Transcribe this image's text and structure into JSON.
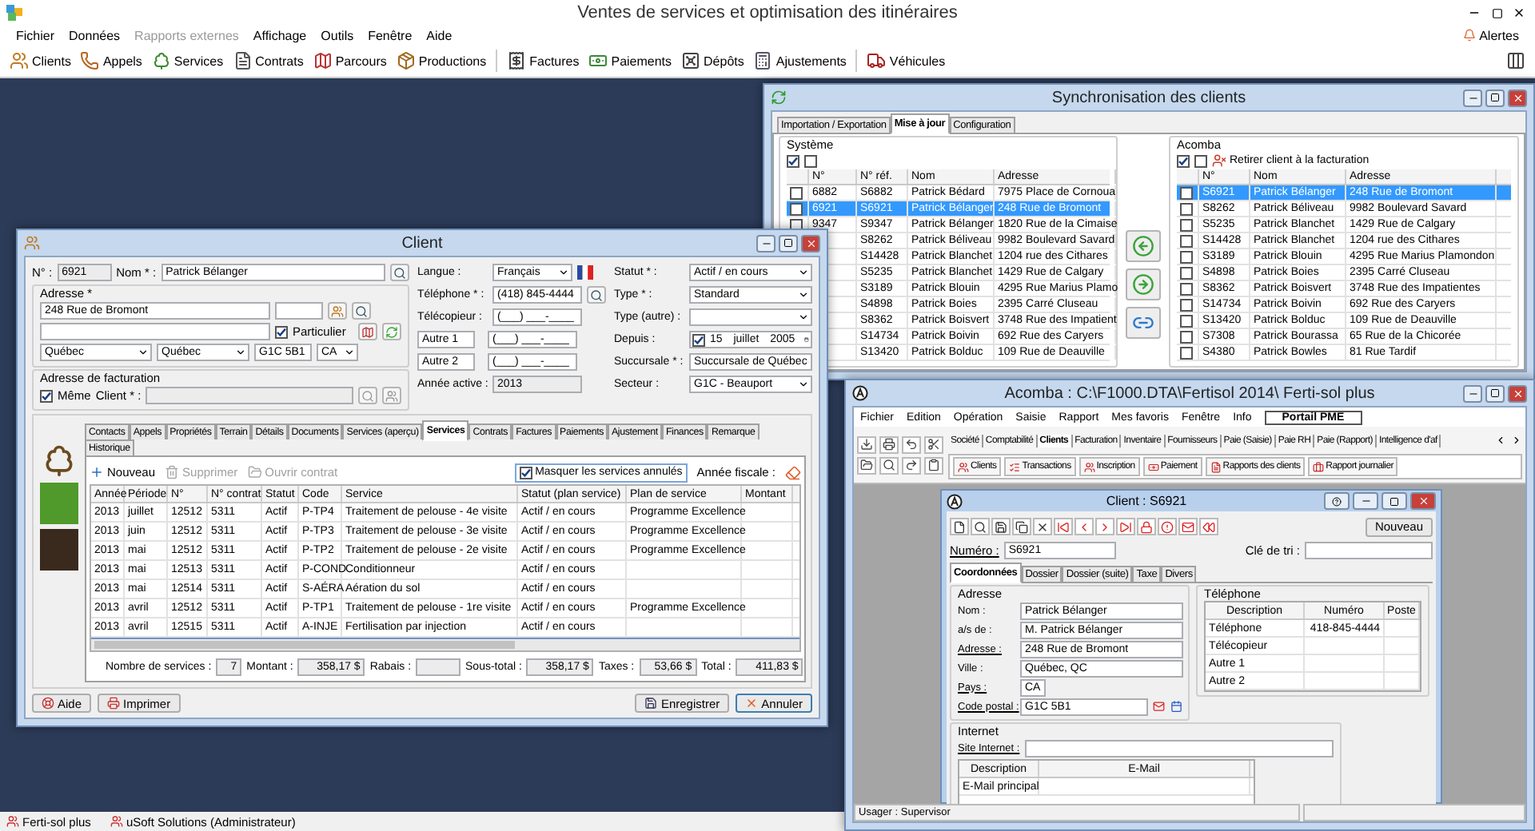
{
  "app": {
    "title": "Ventes de services et optimisation des itinéraires",
    "menu": [
      {
        "label": "Fichier",
        "disabled": false
      },
      {
        "label": "Données",
        "disabled": false
      },
      {
        "label": "Rapports externes",
        "disabled": true
      },
      {
        "label": "Affichage",
        "disabled": false
      },
      {
        "label": "Outils",
        "disabled": false
      },
      {
        "label": "Fenêtre",
        "disabled": false
      },
      {
        "label": "Aide",
        "disabled": false
      }
    ],
    "alerts": "Alertes",
    "toolbar": [
      "Clients",
      "Appels",
      "Services",
      "Contrats",
      "Parcours",
      "Productions",
      "Factures",
      "Paiements",
      "Dépôts",
      "Ajustements",
      "Véhicules"
    ],
    "status_bar": [
      "Ferti-sol plus",
      "uSoft Solutions (Administrateur)"
    ]
  },
  "sync_window": {
    "title": "Synchronisation des clients",
    "tabs": [
      {
        "label": "Importation / Exportation",
        "selected": false
      },
      {
        "label": "Mise à jour",
        "selected": true
      },
      {
        "label": "Configuration",
        "selected": false
      }
    ],
    "system": {
      "legend": "Système",
      "bulk": [
        {
          "checked": true
        },
        {
          "checked": false
        }
      ],
      "columns": [
        "N°",
        "N° réf.",
        "Nom",
        "Adresse"
      ],
      "rows": [
        {
          "no": "6882",
          "checked": false,
          "selected": false,
          "ref": "S6882",
          "name": "Patrick Bédard",
          "address": "7975 Place de Cornoua"
        },
        {
          "no": "6921",
          "checked": false,
          "selected": true,
          "ref": "S6921",
          "name": "Patrick Bélanger",
          "address": "248 Rue de Bromont"
        },
        {
          "no": "9347",
          "checked": false,
          "selected": false,
          "ref": "S9347",
          "name": "Patrick Bélanger",
          "address": "1820 Rue de la Cimaise"
        },
        {
          "selected": false,
          "ref": "S8262",
          "name": "Patrick Béliveau",
          "address": "9982 Boulevard Savard"
        },
        {
          "selected": false,
          "ref": "S14428",
          "name": "Patrick Blanchet",
          "address": "1204 rue des Cithares"
        },
        {
          "selected": false,
          "ref": "S5235",
          "name": "Patrick Blanchet",
          "address": "1429 Rue de Calgary"
        },
        {
          "selected": false,
          "ref": "S3189",
          "name": "Patrick Blouin",
          "address": "4295 Rue Marius Plamo"
        },
        {
          "selected": false,
          "ref": "S4898",
          "name": "Patrick Boies",
          "address": "2395 Carré Cluseau"
        },
        {
          "selected": false,
          "ref": "S8362",
          "name": "Patrick Boisvert",
          "address": "3748 Rue des Impatient"
        },
        {
          "selected": false,
          "ref": "S14734",
          "name": "Patrick Boivin",
          "address": "692 Rue des Caryers"
        },
        {
          "selected": false,
          "ref": "S13420",
          "name": "Patrick Bolduc",
          "address": "109 Rue de Deauville"
        }
      ]
    },
    "acomba": {
      "legend": "Acomba",
      "bulk": [
        {
          "checked": true
        },
        {
          "checked": false
        }
      ],
      "remove_button": "Retirer client à la facturation",
      "columns": [
        "N°",
        "Nom",
        "Adresse"
      ],
      "rows": [
        {
          "no": "S6921",
          "checked": false,
          "selected": true,
          "name": "Patrick Bélanger",
          "address": "248 Rue de Bromont"
        },
        {
          "no": "S8262",
          "checked": false,
          "selected": false,
          "name": "Patrick Béliveau",
          "address": "9982 Boulevard Savard"
        },
        {
          "no": "S5235",
          "checked": false,
          "selected": false,
          "name": "Patrick Blanchet",
          "address": "1429 Rue de Calgary"
        },
        {
          "no": "S14428",
          "checked": false,
          "selected": false,
          "name": "Patrick Blanchet",
          "address": "1204 rue des Cithares"
        },
        {
          "no": "S3189",
          "checked": false,
          "selected": false,
          "name": "Patrick Blouin",
          "address": "4295 Rue Marius Plamondon"
        },
        {
          "no": "S4898",
          "checked": false,
          "selected": false,
          "name": "Patrick Boies",
          "address": "2395 Carré Cluseau"
        },
        {
          "no": "S8362",
          "checked": false,
          "selected": false,
          "name": "Patrick Boisvert",
          "address": "3748 Rue des Impatientes"
        },
        {
          "no": "S14734",
          "checked": false,
          "selected": false,
          "name": "Patrick Boivin",
          "address": "692 Rue des Caryers"
        },
        {
          "no": "S13420",
          "checked": false,
          "selected": false,
          "name": "Patrick Bolduc",
          "address": "109 Rue de Deauville"
        },
        {
          "no": "S7308",
          "checked": false,
          "selected": false,
          "name": "Patrick Bourassa",
          "address": "65 Rue de la Chicorée"
        },
        {
          "no": "S4380",
          "checked": false,
          "selected": false,
          "name": "Patrick Bowles",
          "address": "81 Rue Tardif"
        }
      ]
    }
  },
  "client_window": {
    "title": "Client",
    "number": {
      "label": "N° :",
      "value": "6921"
    },
    "name": {
      "label": "Nom * :",
      "value": "Patrick Bélanger"
    },
    "address": {
      "legend": "Adresse *",
      "line1": "248 Rue de Bromont",
      "particulier": {
        "label": "Particulier",
        "checked": true
      },
      "city": "Québec",
      "province": "Québec",
      "postal_code": "G1C 5B1",
      "country": "CA"
    },
    "billing": {
      "legend": "Adresse de facturation",
      "same": {
        "label": "Même",
        "checked": true
      },
      "client_label": "Client * :"
    },
    "middle": [
      {
        "kind": "select-flag",
        "label": "Langue :",
        "value": "Français"
      },
      {
        "kind": "phone",
        "label": "Téléphone * :",
        "value": "(418) 845-4444"
      },
      {
        "kind": "text",
        "label": "Télécopieur :",
        "value": "(___) ___-____"
      },
      {
        "kind": "boxed",
        "label": "Autre 1",
        "value": "(___) ___-____"
      },
      {
        "kind": "boxed",
        "label": "Autre 2",
        "value": "(___) ___-____"
      },
      {
        "kind": "readonly",
        "label": "Année active :",
        "value": "2013"
      }
    ],
    "right": [
      {
        "kind": "select",
        "label": "Statut * :",
        "value": "Actif / en cours"
      },
      {
        "kind": "select",
        "label": "Type * :",
        "value": "Standard"
      },
      {
        "kind": "select",
        "label": "Type (autre) :"
      },
      {
        "kind": "date",
        "label": "Depuis :",
        "checked": true,
        "value": "15 juillet 2005"
      },
      {
        "kind": "select",
        "label": "Succursale * :",
        "value": "Succursale de Québec"
      },
      {
        "kind": "select",
        "label": "Secteur :",
        "value": "G1C - Beauport"
      }
    ],
    "tabs": [
      {
        "label": "Contacts",
        "selected": false
      },
      {
        "label": "Appels",
        "selected": false
      },
      {
        "label": "Propriétés",
        "selected": false
      },
      {
        "label": "Terrain",
        "selected": false
      },
      {
        "label": "Détails",
        "selected": false
      },
      {
        "label": "Documents",
        "selected": false
      },
      {
        "label": "Services (aperçu)",
        "selected": false
      },
      {
        "label": "Services",
        "selected": true
      },
      {
        "label": "Contrats",
        "selected": false
      },
      {
        "label": "Factures",
        "selected": false
      },
      {
        "label": "Paiements",
        "selected": false
      },
      {
        "label": "Ajustement",
        "selected": false
      },
      {
        "label": "Finances",
        "selected": false
      },
      {
        "label": "Remarque",
        "selected": false
      },
      {
        "label": "Historique",
        "selected": false
      }
    ],
    "toolbar": [
      {
        "label": "Nouveau",
        "disabled": false
      },
      {
        "label": "Supprimer",
        "disabled": true
      },
      {
        "label": "Ouvrir contrat",
        "disabled": true
      }
    ],
    "hide_cancelled": {
      "label": "Masquer les services annulés",
      "checked": true
    },
    "fiscal_year_label": "Année fiscale :",
    "table": {
      "columns": [
        "Année",
        "Période",
        "N°",
        "N° contrat",
        "Statut",
        "Code",
        "Service",
        "Statut (plan service)",
        "Plan de service",
        "Montant"
      ],
      "rows": [
        [
          "2013",
          "juillet",
          "12512",
          "5311",
          "Actif",
          "P-TP4",
          "Traitement de pelouse - 4e visite",
          "Actif / en cours",
          "Programme Excellence"
        ],
        [
          "2013",
          "juin",
          "12512",
          "5311",
          "Actif",
          "P-TP3",
          "Traitement de pelouse - 3e visite",
          "Actif / en cours",
          "Programme Excellence"
        ],
        [
          "2013",
          "mai",
          "12512",
          "5311",
          "Actif",
          "P-TP2",
          "Traitement de pelouse - 2e visite",
          "Actif / en cours",
          "Programme Excellence"
        ],
        [
          "2013",
          "mai",
          "12513",
          "5311",
          "Actif",
          "P-COND",
          "Conditionneur",
          "Actif / en cours"
        ],
        [
          "2013",
          "mai",
          "12514",
          "5311",
          "Actif",
          "S-AÉRA",
          "Aération du sol",
          "Actif / en cours"
        ],
        [
          "2013",
          "avril",
          "12512",
          "5311",
          "Actif",
          "P-TP1",
          "Traitement de pelouse - 1re visite",
          "Actif / en cours",
          "Programme Excellence"
        ],
        [
          "2013",
          "avril",
          "12515",
          "5311",
          "Actif",
          "A-INJE",
          "Fertilisation par injection",
          "Actif / en cours"
        ]
      ]
    },
    "totals": [
      {
        "label": "Nombre de services :",
        "value": "7"
      },
      {
        "label": "Montant :",
        "value": "358,17 $"
      },
      {
        "label": "Rabais :"
      },
      {
        "label": "Sous-total :",
        "value": "358,17 $"
      },
      {
        "label": "Taxes :",
        "value": "53,66 $"
      },
      {
        "label": "Total :",
        "value": "411,83 $"
      }
    ],
    "buttons_left": [
      {
        "label": "Aide",
        "default": false
      },
      {
        "label": "Imprimer",
        "default": false
      }
    ],
    "buttons_right": [
      {
        "label": "Enregistrer",
        "default": false
      },
      {
        "label": "Annuler",
        "default": true
      }
    ]
  },
  "acomba_window": {
    "title": "Acomba : C:\\F1000.DTA\\Fertisol 2014\\  Ferti-sol plus",
    "menu": [
      {
        "label": "Fichier",
        "highlighted": false
      },
      {
        "label": "Edition",
        "highlighted": false
      },
      {
        "label": "Opération",
        "highlighted": false
      },
      {
        "label": "Saisie",
        "highlighted": false
      },
      {
        "label": "Rapport",
        "highlighted": false
      },
      {
        "label": "Mes favoris",
        "highlighted": false
      },
      {
        "label": "Fenêtre",
        "highlighted": false
      },
      {
        "label": "Info",
        "highlighted": false
      },
      {
        "label": "Portail PME",
        "highlighted": true
      }
    ],
    "tabs": [
      {
        "label": "Société",
        "selected": false
      },
      {
        "label": "Comptabilité",
        "selected": false
      },
      {
        "label": "Clients",
        "selected": true
      },
      {
        "label": "Facturation",
        "selected": false
      },
      {
        "label": "Inventaire",
        "selected": false
      },
      {
        "label": "Fournisseurs",
        "selected": false
      },
      {
        "label": "Paie (Saisie)",
        "selected": false
      },
      {
        "label": "Paie RH",
        "selected": false
      },
      {
        "label": "Paie (Rapport)",
        "selected": false
      },
      {
        "label": "Intelligence d'af",
        "selected": false
      }
    ],
    "buttons": [
      "Clients",
      "Transactions",
      "Inscription",
      "Paiement",
      "Rapports des clients",
      "Rapport journalier"
    ],
    "client": {
      "title": "Client : S6921",
      "new_button": "Nouveau",
      "number": {
        "label": "Numéro :",
        "value": "S6921",
        "underlined": true
      },
      "sort_key": {
        "label": "Clé de tri :",
        "underlined": false
      },
      "tabs": [
        {
          "label": "Coordonnées",
          "selected": true
        },
        {
          "label": "Dossier",
          "selected": false
        },
        {
          "label": "Dossier (suite)",
          "selected": false
        },
        {
          "label": "Taxe",
          "selected": false
        },
        {
          "label": "Divers",
          "selected": false
        }
      ],
      "address": {
        "legend": "Adresse",
        "fields": [
          {
            "label": "Nom :",
            "value": "Patrick Bélanger",
            "underlined": false
          },
          {
            "label": "a/s de :",
            "value": "M. Patrick Bélanger",
            "underlined": false
          },
          {
            "label": "Adresse :",
            "value": "248 Rue de Bromont",
            "underlined": true
          },
          {
            "label": "Ville :",
            "value": "Québec, QC",
            "underlined": false
          },
          {
            "label": "Pays :",
            "value": "CA",
            "underlined": true
          },
          {
            "label": "Code postal :",
            "value": "G1C 5B1",
            "underlined": true
          }
        ]
      },
      "phone": {
        "legend": "Téléphone",
        "columns": [
          "Description",
          "Numéro",
          "Poste"
        ],
        "rows": [
          [
            "Téléphone",
            "418-845-4444"
          ],
          [
            "Télécopieur"
          ],
          [
            "Autre 1"
          ],
          [
            "Autre 2"
          ]
        ]
      },
      "internet": {
        "legend": "Internet",
        "site_label": "Site Internet :",
        "columns": [
          "Description",
          "E-Mail"
        ],
        "rows": [
          [
            "E-Mail principal"
          ]
        ]
      }
    },
    "status_bar": "Usager : Supervisor"
  }
}
